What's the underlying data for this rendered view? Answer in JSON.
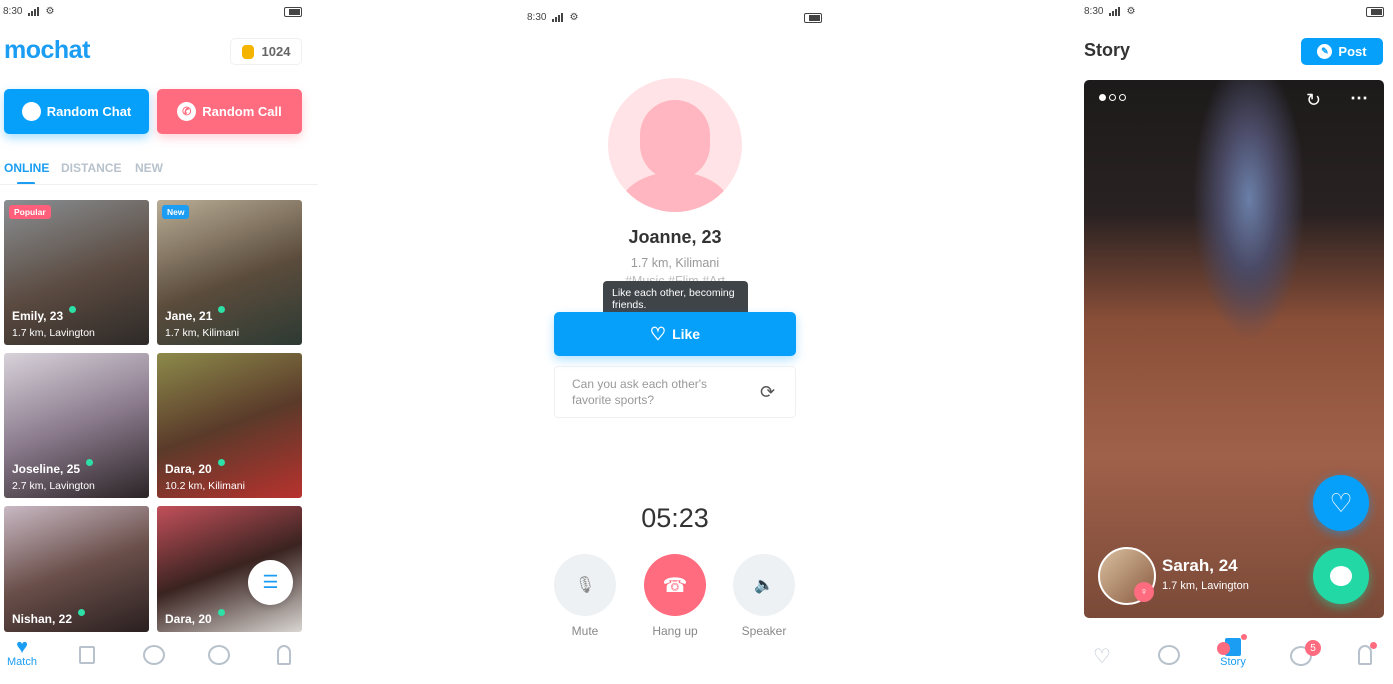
{
  "status": {
    "time": "8:30"
  },
  "left": {
    "logo": "mochat",
    "coins": "1024",
    "random_chat": "Random Chat",
    "random_call": "Random Call",
    "tabs": [
      {
        "label": "ONLINE",
        "active": true
      },
      {
        "label": "DISTANCE"
      },
      {
        "label": "NEW"
      }
    ],
    "cards": [
      {
        "name": "Emily, 23",
        "location": "1.7 km, Lavington",
        "badge": "Popular",
        "badge_color": "#ff5f7a"
      },
      {
        "name": "Jane, 21",
        "location": "1.7 km, Kilimani",
        "badge": "New",
        "badge_color": "#1a9df2"
      },
      {
        "name": "Joseline, 25",
        "location": "2.7 km, Lavington"
      },
      {
        "name": "Dara, 20",
        "location": "10.2 km, Kilimani"
      },
      {
        "name": "Nishan, 22",
        "location": ""
      },
      {
        "name": "Dara, 20",
        "location": ""
      }
    ],
    "nav": [
      {
        "label": "Match",
        "icon": "heart-icon",
        "active": true
      },
      {
        "icon": "cards-icon"
      },
      {
        "icon": "chat-icon"
      },
      {
        "icon": "bubbles-icon"
      },
      {
        "icon": "profile-icon"
      }
    ]
  },
  "call": {
    "name": "Joanne, 23",
    "location": "1.7 km, Kilimani",
    "tags": "#Music  #Flim  #Art",
    "tooltip": "Like each other, becoming friends.",
    "like": "Like",
    "question": "Can you ask each other's favorite sports?",
    "timer": "05:23",
    "controls": [
      {
        "label": "Mute",
        "icon": "mic-off-icon"
      },
      {
        "label": "Hang up",
        "icon": "hang-up-icon"
      },
      {
        "label": "Speaker",
        "icon": "speaker-icon"
      }
    ]
  },
  "story": {
    "title": "Story",
    "post": "Post",
    "name": "Sarah, 24",
    "location": "1.7 km, Lavington",
    "nav": [
      {
        "icon": "heart-icon"
      },
      {
        "icon": "bubbles-icon"
      },
      {
        "label": "Story",
        "icon": "story-icon",
        "active": true
      },
      {
        "icon": "chat-icon",
        "badge": "5"
      },
      {
        "icon": "profile-icon"
      }
    ]
  },
  "colors": {
    "primary": "#1a9df2",
    "pink": "#ff6b7f",
    "green": "#22d8a5"
  }
}
